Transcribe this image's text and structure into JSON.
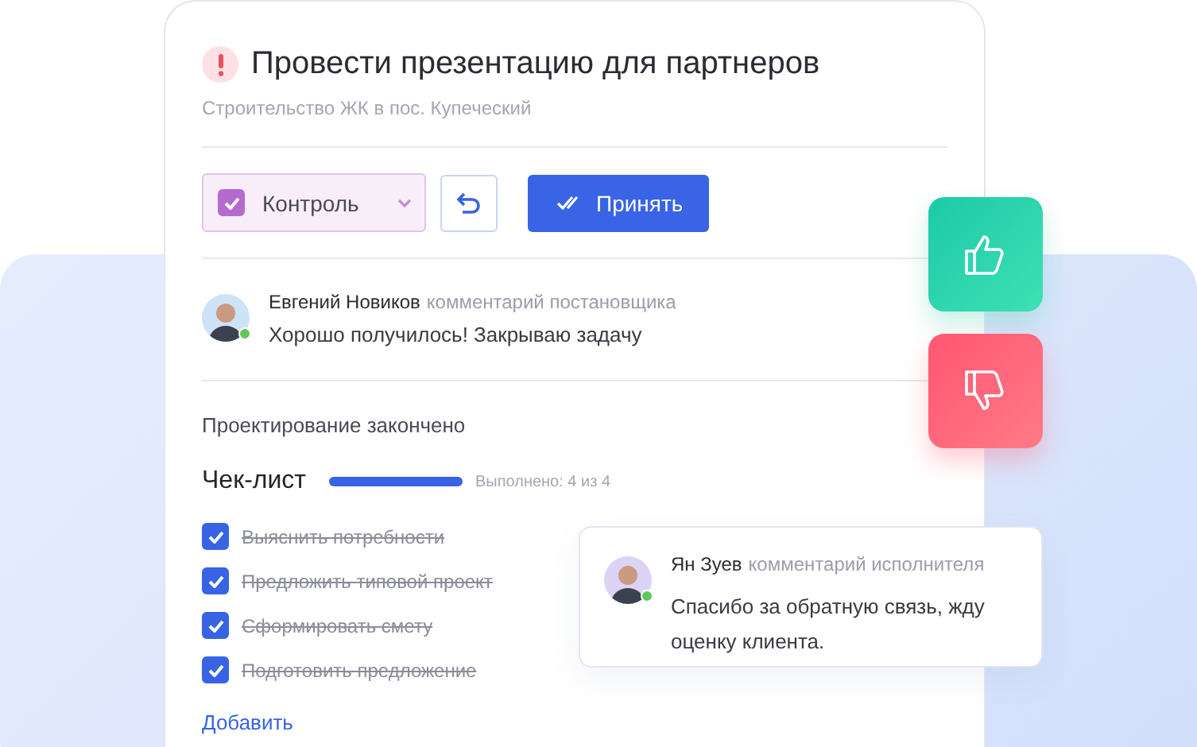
{
  "task": {
    "title": "Провести презентацию для партнеров",
    "project": "Строительство ЖК в пос. Купеческий"
  },
  "status_select": {
    "label": "Контроль",
    "checked": true
  },
  "accept_button": {
    "label": "Принять"
  },
  "manager_comment": {
    "author": "Евгений Новиков",
    "role": "комментарий постановщика",
    "text": "Хорошо получилось! Закрываю задачу",
    "online": true
  },
  "result_text": "Проектирование закончено",
  "checklist": {
    "title": "Чек-лист",
    "level": 1,
    "progress_text": "Выполнено: 4 из 4",
    "add_link": "Добавить",
    "items": [
      {
        "label": "Выяснить потребности",
        "checked": true
      },
      {
        "label": "Предложить типовой проект",
        "checked": true
      },
      {
        "label": "Сформировать смету",
        "checked": true
      },
      {
        "label": "Подготовить предложение",
        "checked": true
      }
    ]
  },
  "executor_comment": {
    "author": "Ян Зуев",
    "role": "комментарий исполнителя",
    "text": "Спасибо за обратную связь, жду оценку клиента.",
    "online": true
  }
}
